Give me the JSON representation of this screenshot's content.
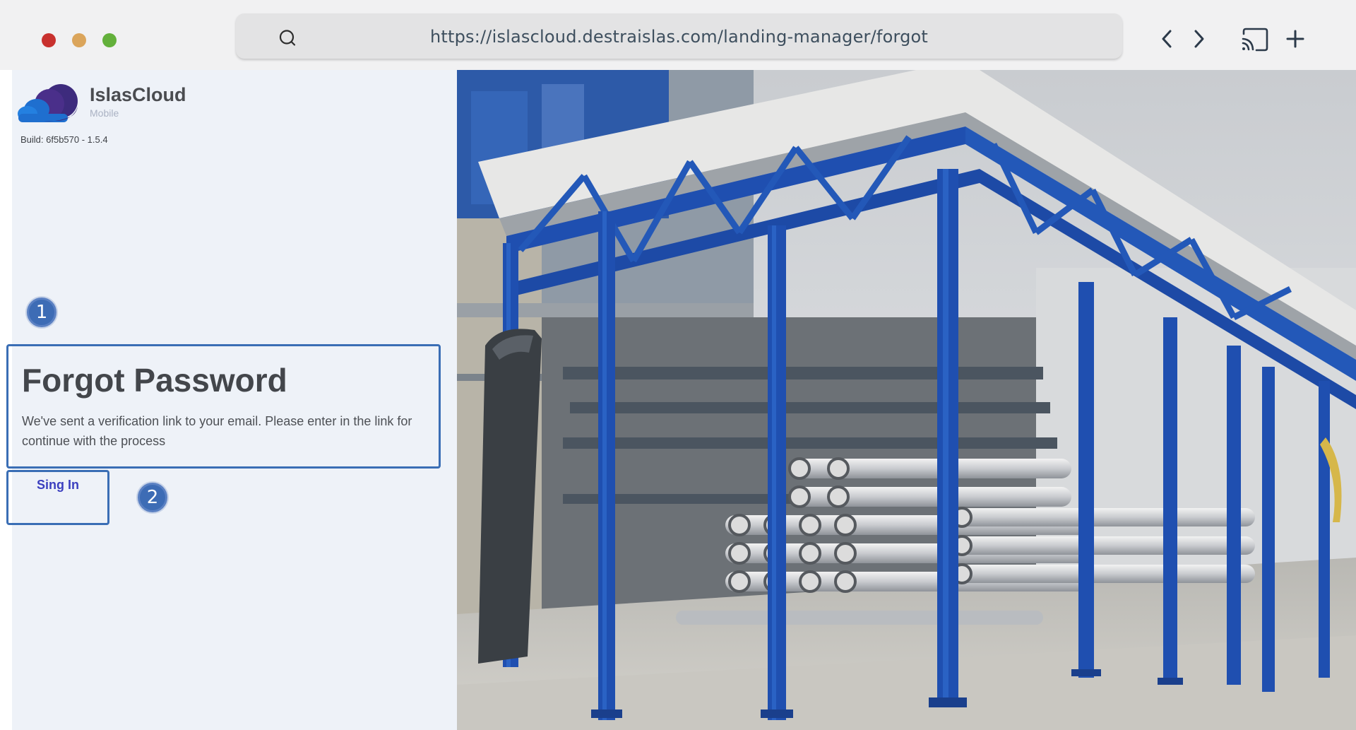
{
  "browser": {
    "url": "https://islascloud.destraislas.com/landing-manager/forgot",
    "icons": [
      "search-icon",
      "chevron-left-icon",
      "chevron-right-icon",
      "cast-icon",
      "plus-icon"
    ]
  },
  "app": {
    "name": "IslasCloud",
    "subtitle": "Mobile",
    "build": "Build: 6f5b570 - 1.5.4"
  },
  "markers": [
    "1",
    "2"
  ],
  "forgot": {
    "title": "Forgot Password",
    "message": "We've sent a verification link to your email. Please enter in the link for continue with the process",
    "signin_label": "Sing In"
  },
  "colors": {
    "accent": "#3a6eb5",
    "link": "#3b3fbf",
    "panel_bg": "#eef2f8",
    "steel_blue": "#1f4fb0"
  }
}
